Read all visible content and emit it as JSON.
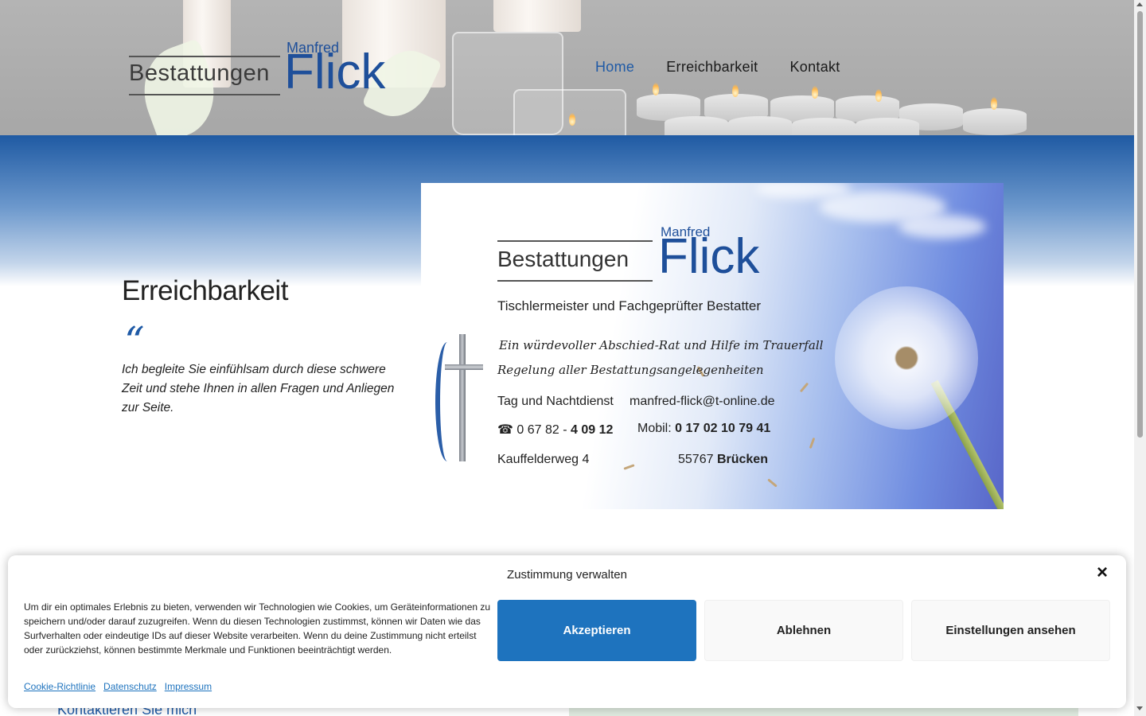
{
  "header": {
    "logo": {
      "bestattungen": "Bestattungen",
      "manfred": "Manfred",
      "flick": "Flick"
    },
    "nav": [
      {
        "label": "Home",
        "active": true
      },
      {
        "label": "Erreichbarkeit",
        "active": false
      },
      {
        "label": "Kontakt",
        "active": false
      }
    ]
  },
  "hero": {
    "title": "Erreichbarkeit",
    "quote_mark": "“",
    "quote": "Ich begleite Sie einfühlsam durch diese schwere Zeit und stehe Ihnen in allen Fragen und Anliegen zur Seite."
  },
  "card": {
    "bestattungen": "Bestattungen",
    "manfred": "Manfred",
    "flick": "Flick",
    "subtitle": "Tischlermeister und Fachgeprüfter Bestatter",
    "script1": "Ein würdevoller Abschied-Rat und Hilfe im Trauerfall",
    "script2": "Regelung aller Bestattungsangelegenheiten",
    "service": "Tag und Nachtdienst",
    "email": "manfred-flick@t-online.de",
    "phone_icon": "☎",
    "phone_prefix": "0 67 82 -",
    "phone_number": "4 09 12",
    "mobile_label": "Mobil:",
    "mobile_number": "0 17 02 10 79 41",
    "street": "Kauffelderweg 4",
    "zip": "55767",
    "city": "Brücken"
  },
  "below": {
    "contact_heading": "Kontaktieren Sie mich"
  },
  "cookie": {
    "title": "Zustimmung verwalten",
    "close_icon": "×",
    "text": "Um dir ein optimales Erlebnis zu bieten, verwenden wir Technologien wie Cookies, um Geräteinformationen zu speichern und/oder darauf zuzugreifen. Wenn du diesen Technologien zustimmst, können wir Daten wie das Surfverhalten oder eindeutige IDs auf dieser Website verarbeiten. Wenn du deine Zustimmung nicht erteilst oder zurückziehst, können bestimmte Merkmale und Funktionen beeinträchtigt werden.",
    "accept": "Akzeptieren",
    "deny": "Ablehnen",
    "settings": "Einstellungen ansehen",
    "links": [
      "Cookie-Richtlinie",
      "Datenschutz",
      "Impressum"
    ]
  },
  "colors": {
    "brand_blue": "#1e4f9a",
    "accent_button": "#1e73be",
    "nav_active": "#1f5aa6"
  }
}
